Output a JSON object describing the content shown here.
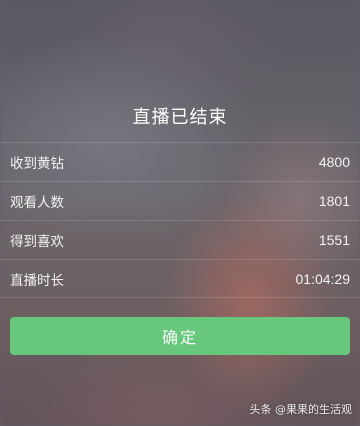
{
  "dialog": {
    "title": "直播已结束",
    "stats": [
      {
        "label": "收到黄钻",
        "value": "4800"
      },
      {
        "label": "观看人数",
        "value": "1801"
      },
      {
        "label": "得到喜欢",
        "value": "1551"
      },
      {
        "label": "直播时长",
        "value": "01:04:29"
      }
    ],
    "confirm_label": "确定"
  },
  "watermark": "头条 @果果的生活观",
  "colors": {
    "confirm_button": "#66c77d",
    "text": "#ffffff"
  }
}
